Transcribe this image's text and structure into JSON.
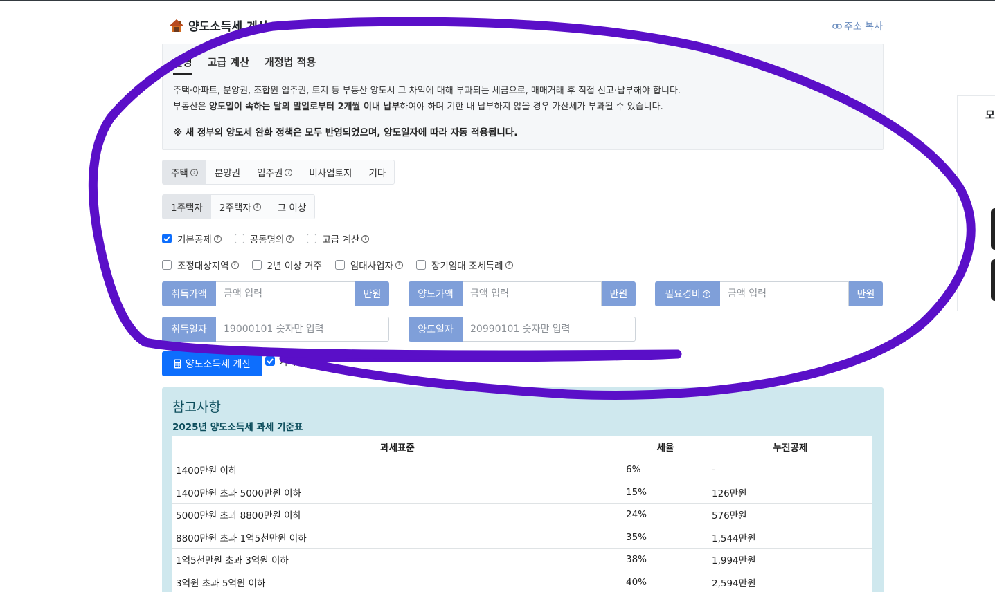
{
  "page": {
    "title": "양도소득세 계산",
    "copy_link": "주소 복사"
  },
  "info": {
    "tabs": [
      "설명",
      "고급 계산",
      "개정법 적용"
    ],
    "line1": "주택·아파트, 분양권, 조합원 입주권, 토지 등 부동산 양도시 그 차익에 대해 부과되는 세금으로, 매매거래 후 직접 신고·납부해야 합니다.",
    "line2_pre": "부동산은 ",
    "line2_bold": "양도일이 속하는 달의 말일로부터 2개월 이내 납부",
    "line2_post": "하여야 하며 기한 내 납부하지 않을 경우 가산세가 부과될 수 있습니다.",
    "note": "※ 새 정부의 양도세 완화 정책은 모두 반영되었으며, 양도일자에 따라 자동 적용됩니다."
  },
  "property_types": [
    "주택",
    "분양권",
    "입주권",
    "비사업토지",
    "기타"
  ],
  "owner_counts": [
    "1주택자",
    "2주택자",
    "그 이상"
  ],
  "checks_row1": [
    {
      "label": "기본공제",
      "checked": true
    },
    {
      "label": "공동명의",
      "checked": false
    },
    {
      "label": "고급 계산",
      "checked": false
    }
  ],
  "checks_row2": [
    {
      "label": "조정대상지역",
      "checked": false
    },
    {
      "label": "2년 이상 거주",
      "checked": false
    },
    {
      "label": "임대사업자",
      "checked": false
    },
    {
      "label": "장기임대 조세특례",
      "checked": false
    }
  ],
  "inputs": {
    "acq_price_label": "취득가액",
    "acq_price_placeholder": "금액 입력",
    "sale_price_label": "양도가액",
    "sale_price_placeholder": "금액 입력",
    "expense_label": "필요경비",
    "expense_placeholder": "금액 입력",
    "unit": "만원",
    "acq_date_label": "취득일자",
    "acq_date_placeholder": "19000101 숫자만 입력",
    "sale_date_label": "양도일자",
    "sale_date_placeholder": "20990101 숫자만 입력"
  },
  "calc_button": "양도소득세 계산",
  "record_label": "기록",
  "reference": {
    "title": "참고사항",
    "subtitle": "2025년 양도소득세 과세 기준표",
    "headers": [
      "과세표준",
      "세율",
      "누진공제"
    ],
    "rows": [
      [
        "1400만원 이하",
        "6%",
        "-"
      ],
      [
        "1400만원 초과 5000만원 이하",
        "15%",
        "126만원"
      ],
      [
        "5000만원 초과 8800만원 이하",
        "24%",
        "576만원"
      ],
      [
        "8800만원 초과 1억5천만원 이하",
        "35%",
        "1,544만원"
      ],
      [
        "1억5천만원 초과 3억원 이하",
        "38%",
        "1,994만원"
      ],
      [
        "3억원 초과 5억원 이하",
        "40%",
        "2,594만원"
      ]
    ]
  },
  "side_panel_char": "모",
  "colors": {
    "primary": "#0d6efd",
    "input_label_bg": "#7f9fd9",
    "ref_bg": "#cfe8ee",
    "annotation_stroke": "#5a0fc8"
  }
}
